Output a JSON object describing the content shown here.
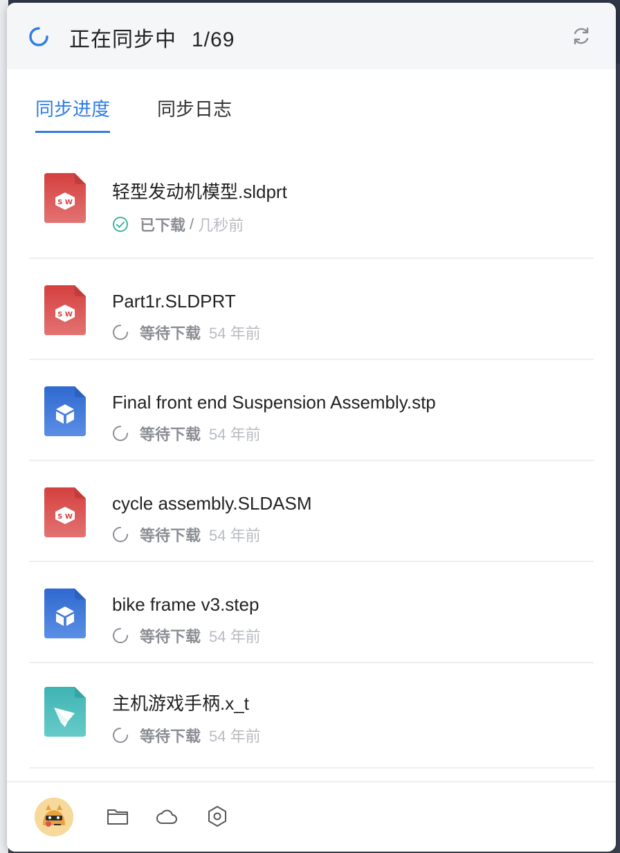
{
  "header": {
    "title": "正在同步中",
    "count": "1/69"
  },
  "tabs": [
    {
      "label": "同步进度",
      "active": true
    },
    {
      "label": "同步日志",
      "active": false
    }
  ],
  "files": [
    {
      "name": "轻型发动机模型.sldprt",
      "icon": "solidworks-file-icon",
      "status": "已下载",
      "status_icon": "check-circle-icon",
      "separator": "/",
      "time": "几秒前"
    },
    {
      "name": "Part1r.SLDPRT",
      "icon": "solidworks-file-icon",
      "status": "等待下载",
      "status_icon": "loading-icon",
      "separator": "",
      "time": "54 年前"
    },
    {
      "name": "Final front end Suspension Assembly.stp",
      "icon": "step-file-icon",
      "status": "等待下载",
      "status_icon": "loading-icon",
      "separator": "",
      "time": "54 年前"
    },
    {
      "name": "cycle assembly.SLDASM",
      "icon": "solidworks-file-icon",
      "status": "等待下载",
      "status_icon": "loading-icon",
      "separator": "",
      "time": "54 年前"
    },
    {
      "name": "bike frame v3.step",
      "icon": "step-file-icon",
      "status": "等待下载",
      "status_icon": "loading-icon",
      "separator": "",
      "time": "54 年前"
    },
    {
      "name": "主机游戏手柄.x_t",
      "icon": "parasolid-file-icon",
      "status": "等待下载",
      "status_icon": "loading-icon",
      "separator": "",
      "time": "54 年前"
    }
  ],
  "colors": {
    "accent": "#2f7de6",
    "solidworks": "#d9544f",
    "step": "#3f79d8",
    "parasolid": "#4dbdbd",
    "success": "#3db39e"
  },
  "footer": {
    "icons": [
      "avatar",
      "folder-icon",
      "cloud-icon",
      "settings-icon"
    ]
  }
}
